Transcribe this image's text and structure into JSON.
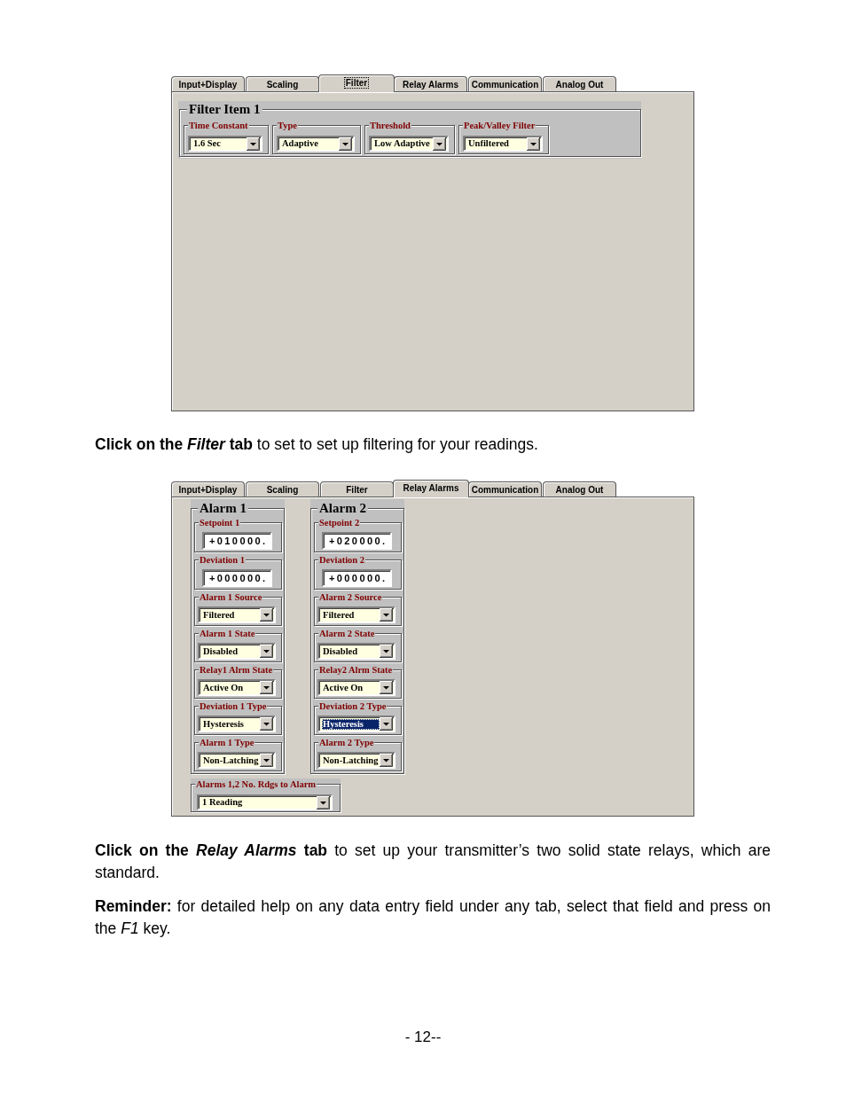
{
  "filter_window": {
    "tabs": [
      {
        "label": "Input+Display",
        "selected": false,
        "focused": false
      },
      {
        "label": "Scaling",
        "selected": false,
        "focused": false
      },
      {
        "label": "Filter",
        "selected": true,
        "focused": true
      },
      {
        "label": "Relay Alarms",
        "selected": false,
        "focused": false
      },
      {
        "label": "Communication",
        "selected": false,
        "focused": false
      },
      {
        "label": "Analog Out",
        "selected": false,
        "focused": false
      }
    ],
    "group": {
      "title": "Filter Item 1",
      "fields": [
        {
          "label": "Time Constant",
          "value": "1.6 Sec"
        },
        {
          "label": "Type",
          "value": "Adaptive"
        },
        {
          "label": "Threshold",
          "value": "Low Adaptive"
        },
        {
          "label": "Peak/Valley Filter",
          "value": "Unfiltered"
        }
      ]
    }
  },
  "filter_caption": "**Click on the *Filter* tab** to set to set up filtering for your readings.",
  "relay_alarms_window": {
    "tabs": [
      {
        "label": "Input+Display",
        "selected": false,
        "focused": false
      },
      {
        "label": "Scaling",
        "selected": false,
        "focused": false
      },
      {
        "label": "Filter",
        "selected": false,
        "focused": false
      },
      {
        "label": "Relay Alarms",
        "selected": true,
        "focused": false
      },
      {
        "label": "Communication",
        "selected": false,
        "focused": false
      },
      {
        "label": "Analog Out",
        "selected": false,
        "focused": false
      }
    ],
    "alarms": [
      {
        "title": "Alarm 1",
        "fields": [
          {
            "kind": "number",
            "label": "Setpoint 1",
            "value": "+010000.",
            "focused": false
          },
          {
            "kind": "number",
            "label": "Deviation 1",
            "value": "+000000.",
            "focused": false
          },
          {
            "kind": "dropdown",
            "label": "Alarm 1 Source",
            "value": "Filtered",
            "focused": false
          },
          {
            "kind": "dropdown",
            "label": "Alarm 1 State",
            "value": "Disabled",
            "focused": false
          },
          {
            "kind": "dropdown",
            "label": "Relay1 Alrm State",
            "value": "Active On",
            "focused": false
          },
          {
            "kind": "dropdown",
            "label": "Deviation 1 Type",
            "value": "Hysteresis",
            "focused": false
          },
          {
            "kind": "dropdown",
            "label": "Alarm 1 Type",
            "value": "Non-Latching",
            "focused": false
          }
        ]
      },
      {
        "title": "Alarm 2",
        "fields": [
          {
            "kind": "number",
            "label": "Setpoint 2",
            "value": "+020000.",
            "focused": false
          },
          {
            "kind": "number",
            "label": "Deviation 2",
            "value": "+000000.",
            "focused": false
          },
          {
            "kind": "dropdown",
            "label": "Alarm 2 Source",
            "value": "Filtered",
            "focused": false
          },
          {
            "kind": "dropdown",
            "label": "Alarm 2 State",
            "value": "Disabled",
            "focused": false
          },
          {
            "kind": "dropdown",
            "label": "Relay2 Alrm State",
            "value": "Active On",
            "focused": false
          },
          {
            "kind": "dropdown",
            "label": "Deviation 2 Type",
            "value": "Hysteresis",
            "focused": true
          },
          {
            "kind": "dropdown",
            "label": "Alarm 2 Type",
            "value": "Non-Latching",
            "focused": false
          }
        ]
      }
    ],
    "readings": {
      "label": "Alarms 1,2 No. Rdgs to Alarm",
      "value": "1 Reading"
    }
  },
  "relay_alarms_caption": "**Click on the *Relay Alarms* tab** to set up your transmitter’s two solid state relays, which are standard.",
  "reminder": "**Reminder:** for detailed help on any data entry field under any tab, select that field and press on the *F1* key.",
  "page_number": "- 12--"
}
